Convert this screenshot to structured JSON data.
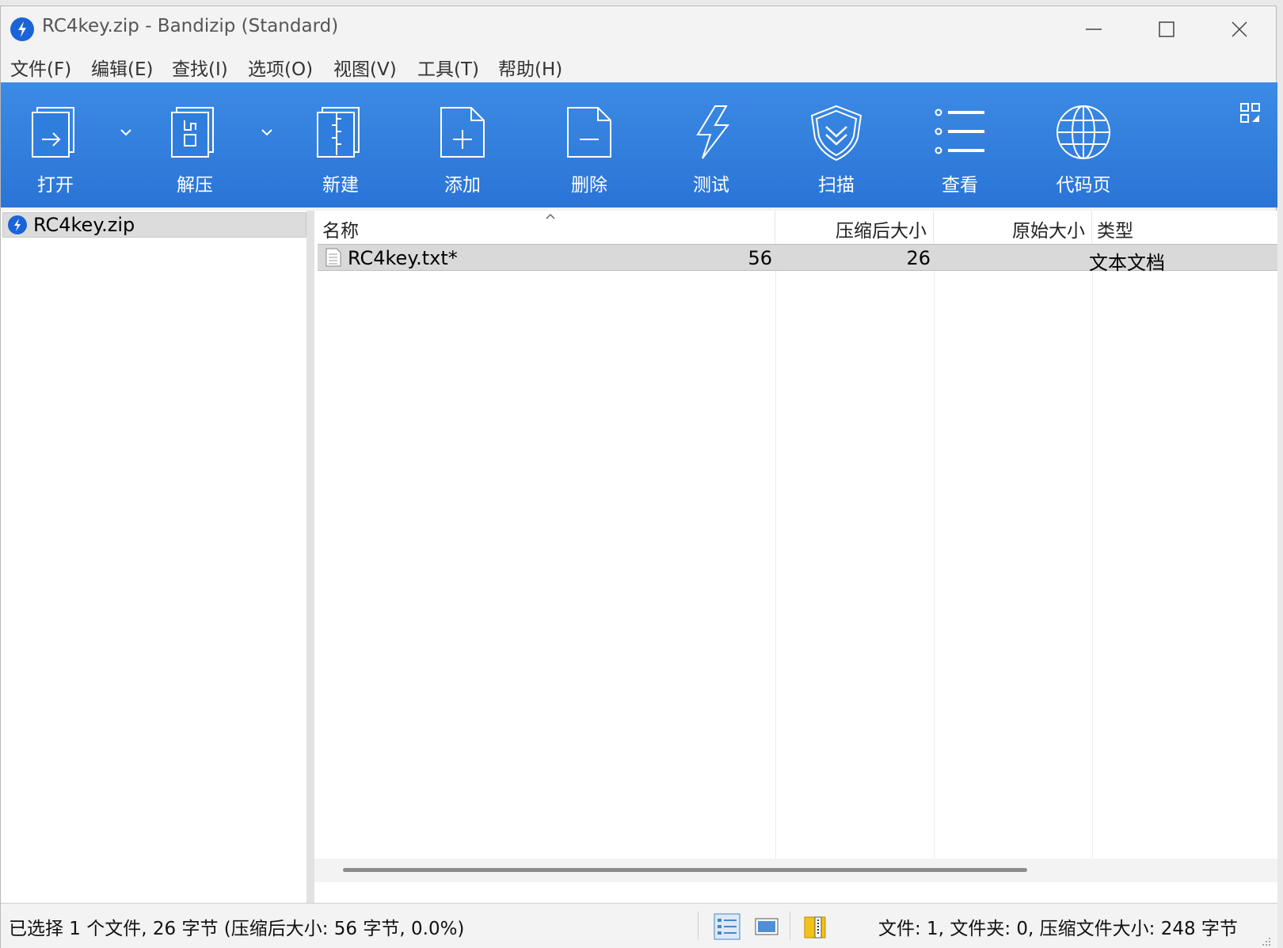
{
  "window": {
    "title": "RC4key.zip - Bandizip (Standard)"
  },
  "menu": [
    {
      "label": "文件(F)"
    },
    {
      "label": "编辑(E)"
    },
    {
      "label": "查找(I)"
    },
    {
      "label": "选项(O)"
    },
    {
      "label": "视图(V)"
    },
    {
      "label": "工具(T)"
    },
    {
      "label": "帮助(H)"
    }
  ],
  "toolbar": {
    "open": "打开",
    "extract": "解压",
    "new": "新建",
    "add": "添加",
    "delete": "删除",
    "test": "测试",
    "scan": "扫描",
    "view": "查看",
    "codepage": "代码页"
  },
  "tree": {
    "root": "RC4key.zip"
  },
  "list": {
    "columns": {
      "name": "名称",
      "compressed": "压缩后大小",
      "original": "原始大小",
      "type": "类型"
    },
    "rows": [
      {
        "name": "RC4key.txt*",
        "compressed": "56",
        "original": "26",
        "type": "文本文档"
      }
    ]
  },
  "status": {
    "selection": "已选择 1 个文件, 26 字节 (压缩后大小: 56 字节, 0.0%)",
    "summary": "文件: 1, 文件夹: 0, 压缩文件大小: 248 字节"
  },
  "colors": {
    "toolbar_accent": "#2a74d6",
    "brand_blue": "#1b64d8"
  }
}
